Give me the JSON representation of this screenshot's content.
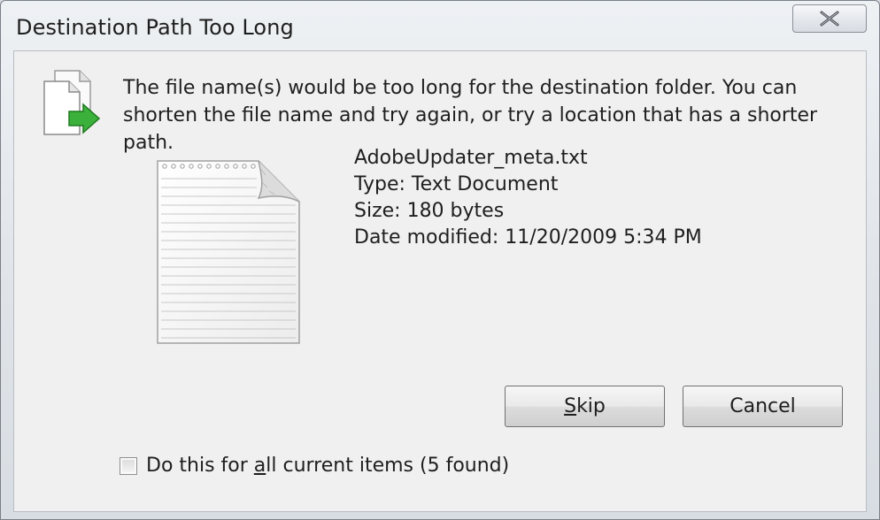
{
  "dialog": {
    "title": "Destination Path Too Long",
    "message": "The file name(s) would be too long for the destination folder.  You can shorten the file name and try again, or try a location that has a shorter path."
  },
  "file": {
    "name": "AdobeUpdater_meta.txt",
    "type_line": "Type: Text Document",
    "size_line": "Size: 180 bytes",
    "date_line": "Date modified: 11/20/2009 5:34 PM"
  },
  "buttons": {
    "skip_label": "Skip",
    "cancel_label": "Cancel"
  },
  "options": {
    "apply_all_prefix": "Do this for ",
    "apply_all_mnemonic": "a",
    "apply_all_rest": "ll current items (5 found)",
    "apply_all_checked": false
  },
  "icons": {
    "close": "close-icon",
    "file_move": "file-move-icon",
    "text_document": "text-document-icon"
  },
  "colors": {
    "arrow_green": "#3bb13b"
  }
}
